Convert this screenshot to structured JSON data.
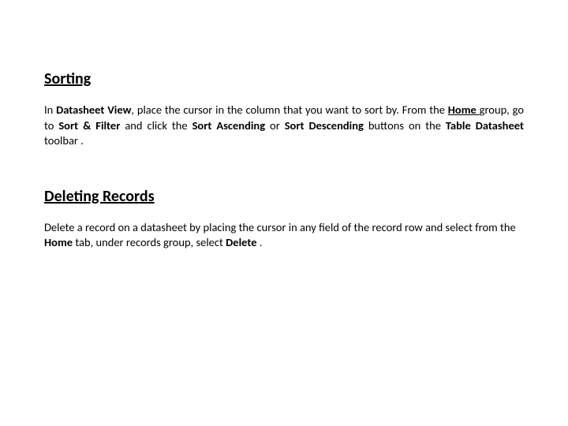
{
  "section1": {
    "heading": "Sorting",
    "p": {
      "t1": "In ",
      "b1": "Datasheet View",
      "t2": ", place the cursor in the column that you want to sort by. From the ",
      "bu1": "Home ",
      "t3": "group, go to ",
      "b2": "Sort & Filter ",
      "t4": "and click the ",
      "b3": "Sort Ascending ",
      "t5": "or ",
      "b4": "Sort Descending ",
      "t6": "buttons on the ",
      "b5": "Table Datasheet ",
      "t7": "toolbar ."
    }
  },
  "section2": {
    "heading": "Deleting Records",
    "p": {
      "t1": "Delete a record on a datasheet by placing the cursor in any field of the record row and select from the ",
      "b1": "Home ",
      "t2": "tab, under records group, select ",
      "b2": "Delete ",
      "t3": "."
    }
  }
}
